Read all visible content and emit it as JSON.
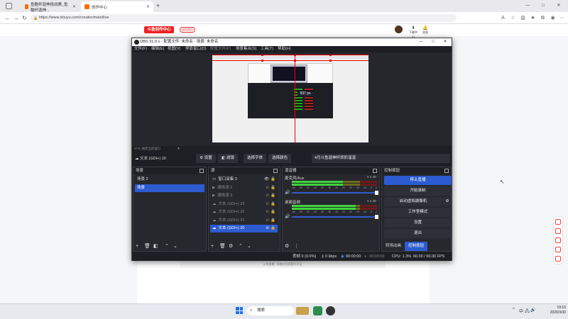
{
  "browser": {
    "tabs": [
      {
        "title": "鱼酷杯迦神挑战赛_鱼酷杯迦神...",
        "active": false
      },
      {
        "title": "创作中心",
        "active": true
      }
    ],
    "new_tab": "+",
    "url": "https://www.douyu.com/creator/main/live",
    "window_controls": [
      "—",
      "□",
      "✕"
    ]
  },
  "site": {
    "logo_text": "斗鱼创作中心",
    "header_button": "返回首页",
    "header_items": [
      "下载中心",
      "消息"
    ],
    "footnote": "斗鱼直播 · 网络文化经营许可证"
  },
  "obs": {
    "title": "OBS 31.0.1 - 配置文件: 未命名 - 场景: 未命名",
    "menu": [
      "文件(F)",
      "编辑(E)",
      "视图(V)",
      "停靠窗口(D)",
      "配置文件(P)",
      "场景集合(S)",
      "工具(T)",
      "帮助(H)"
    ],
    "preview_px_label": "997 px",
    "zoom_text": "27%   捕获当前窗口",
    "source_toolbar": {
      "source_name": "文本 (GDI+) 20",
      "buttons": [
        "设置",
        "滤镜",
        "选择字体",
        "选择颜色"
      ],
      "text_value": "4月斗鱼迦神杯抓抓溜溜"
    },
    "scenes": {
      "title": "场景",
      "items": [
        {
          "label": "场景 2",
          "selected": false
        },
        {
          "label": "场景",
          "selected": true
        }
      ]
    },
    "sources": {
      "title": "源",
      "items": [
        {
          "label": "窗口采集 3",
          "icon": "window-icon",
          "dim": false,
          "selected": false,
          "eye": "👁",
          "lock": "🔒"
        },
        {
          "label": "媒体源 2",
          "icon": "play-icon",
          "dim": true,
          "selected": false,
          "eye": "⊘",
          "lock": "🔒"
        },
        {
          "label": "媒体源 3",
          "icon": "play-icon",
          "dim": true,
          "selected": false,
          "eye": "⊘",
          "lock": "🔒"
        },
        {
          "label": "文本 (GDI+) 23",
          "icon": "text-icon",
          "dim": true,
          "selected": false,
          "eye": "⊘",
          "lock": "🔒"
        },
        {
          "label": "文本 (GDI+) 22",
          "icon": "text-icon",
          "dim": true,
          "selected": false,
          "eye": "⊘",
          "lock": "🔒"
        },
        {
          "label": "文本 (GDI+) 21",
          "icon": "text-icon",
          "dim": true,
          "selected": false,
          "eye": "⊘",
          "lock": "🔒"
        },
        {
          "label": "文本 (GDI+) 20",
          "icon": "text-icon",
          "dim": false,
          "selected": true,
          "eye": "⊘",
          "lock": "🔒"
        }
      ]
    },
    "mixer": {
      "title": "混音器",
      "channels": [
        {
          "name": "麦克风/Aux",
          "db": "0.0 dB",
          "level": 0.6
        },
        {
          "name": "桌面音频",
          "db": "0.0 dB",
          "level": 0.75
        }
      ],
      "scale": [
        "-60",
        "-55",
        "-50",
        "-45",
        "-40",
        "-35",
        "-30",
        "-25",
        "-20",
        "-15",
        "-10",
        "-5",
        "0"
      ]
    },
    "controls": {
      "title": "控制按钮",
      "buttons": [
        {
          "label": "停止直播",
          "primary": true
        },
        {
          "label": "开始录制",
          "primary": false
        },
        {
          "label": "启动虚拟摄像机",
          "primary": false
        },
        {
          "label": "工作室模式",
          "primary": false
        },
        {
          "label": "设置",
          "primary": false
        },
        {
          "label": "退出",
          "primary": false
        }
      ],
      "tabs": [
        {
          "label": "转场动画",
          "active": false
        },
        {
          "label": "控制按钮",
          "active": true
        }
      ]
    },
    "status": {
      "dropped": "丢帧 0 (0.0%)",
      "kbps": "0 kbps",
      "stream_time": "00:00:00",
      "rec_time": "00:00:00",
      "cpu": "CPU: 1.3%",
      "fps": "60.00 / 60.00 FPS"
    }
  },
  "taskbar": {
    "search_placeholder": "搜索",
    "time": "19:10",
    "date": "2026/3/30",
    "tray_lang": "中"
  },
  "colors": {
    "accent": "#2d5bd0",
    "obs_bg": "#1e1f24",
    "brand": "#ff6a00"
  }
}
